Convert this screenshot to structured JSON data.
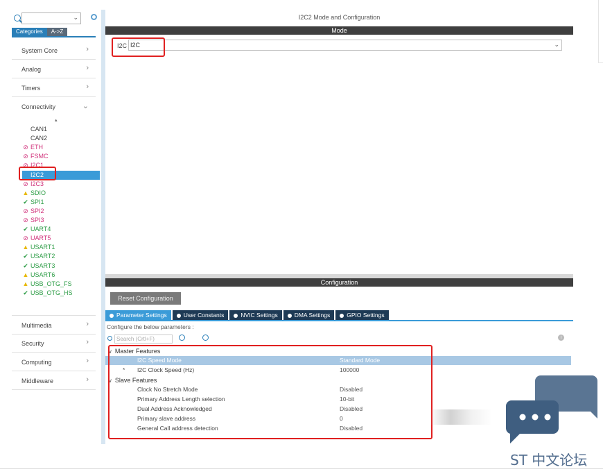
{
  "sidebar": {
    "tabs": [
      "Categories",
      "A->Z"
    ],
    "categories_top": [
      "System Core",
      "Analog",
      "Timers",
      "Connectivity"
    ],
    "peripherals": [
      {
        "name": "CAN1",
        "status": "none"
      },
      {
        "name": "CAN2",
        "status": "none"
      },
      {
        "name": "ETH",
        "status": "blocked"
      },
      {
        "name": "FSMC",
        "status": "blocked"
      },
      {
        "name": "I2C1",
        "status": "blocked"
      },
      {
        "name": "I2C2",
        "status": "selected"
      },
      {
        "name": "I2C3",
        "status": "blocked"
      },
      {
        "name": "SDIO",
        "status": "warning"
      },
      {
        "name": "SPI1",
        "status": "ok"
      },
      {
        "name": "SPI2",
        "status": "blocked"
      },
      {
        "name": "SPI3",
        "status": "blocked"
      },
      {
        "name": "UART4",
        "status": "ok"
      },
      {
        "name": "UART5",
        "status": "blocked"
      },
      {
        "name": "USART1",
        "status": "warning"
      },
      {
        "name": "USART2",
        "status": "ok"
      },
      {
        "name": "USART3",
        "status": "ok"
      },
      {
        "name": "USART6",
        "status": "warning"
      },
      {
        "name": "USB_OTG_FS",
        "status": "warning"
      },
      {
        "name": "USB_OTG_HS",
        "status": "ok"
      }
    ],
    "categories_bottom": [
      "Multimedia",
      "Security",
      "Computing",
      "Middleware"
    ]
  },
  "main": {
    "title": "I2C2 Mode and Configuration",
    "mode_header": "Mode",
    "i2c_label": "I2C",
    "i2c_value": "I2C",
    "config_header": "Configuration",
    "reset_button": "Reset Configuration",
    "tabs": [
      "Parameter Settings",
      "User Constants",
      "NVIC Settings",
      "DMA Settings",
      "GPIO Settings"
    ],
    "hint": "Configure the below parameters :",
    "search_placeholder": "Search (Crtl+F)",
    "groups": {
      "master": "Master Features",
      "slave": "Slave Features"
    },
    "master_params": [
      {
        "name": "I2C Speed Mode",
        "value": "Standard Mode"
      },
      {
        "name": "I2C Clock Speed (Hz)",
        "value": "100000"
      }
    ],
    "slave_params": [
      {
        "name": "Clock No Stretch Mode",
        "value": "Disabled"
      },
      {
        "name": "Primary Address Length selection",
        "value": "10-bit"
      },
      {
        "name": "Dual Address Acknowledged",
        "value": "Disabled"
      },
      {
        "name": "Primary slave address",
        "value": "0"
      },
      {
        "name": "General Call address detection",
        "value": "Disabled"
      }
    ]
  },
  "watermark": {
    "text": "ST 中文论坛"
  },
  "colors": {
    "accent": "#3a9bd8",
    "highlight_box": "#e02020",
    "blocked": "#d0307a",
    "ok": "#2e9d47",
    "warning": "#e8b800"
  }
}
